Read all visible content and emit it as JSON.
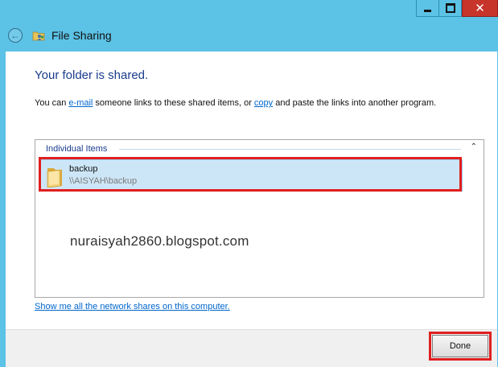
{
  "window": {
    "title": "File Sharing",
    "icon": "file-sharing-icon"
  },
  "caption": {
    "minimize_icon": "minimize-icon",
    "maximize_icon": "maximize-icon",
    "close_glyph": "✕"
  },
  "content": {
    "heading": "Your folder is shared.",
    "desc_part1": "You can ",
    "email_link": "e-mail",
    "desc_part2": " someone links to these shared items, or ",
    "copy_link": "copy",
    "desc_part3": " and paste the links into another program."
  },
  "list": {
    "group_header": "Individual Items",
    "collapse_glyph": "⌃",
    "items": [
      {
        "name": "backup",
        "path": "\\\\AISYAH\\backup",
        "icon": "folder-icon"
      }
    ]
  },
  "watermark": "nuraisyah2860.blogspot.com",
  "footer": {
    "link": "Show me all the network shares on this computer."
  },
  "buttons": {
    "done": "Done"
  },
  "colors": {
    "frame": "#5cc2e6",
    "heading": "#1a3c8c",
    "link": "#0066cc",
    "selection": "#cde6f7",
    "highlight": "#e01f1f"
  }
}
